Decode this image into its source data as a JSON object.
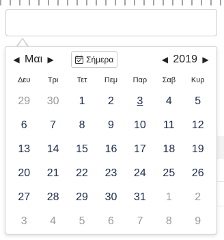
{
  "datepicker": {
    "input_value": "",
    "month": "Μαι",
    "year": "2019",
    "today_label": "Σήμερα",
    "weekdays": [
      "Δευ",
      "Τρι",
      "Τετ",
      "Πεμ",
      "Παρ",
      "Σαβ",
      "Κυρ"
    ],
    "weeks": [
      [
        {
          "d": "29",
          "other": true
        },
        {
          "d": "30",
          "other": true
        },
        {
          "d": "1"
        },
        {
          "d": "2"
        },
        {
          "d": "3",
          "today": true
        },
        {
          "d": "4"
        },
        {
          "d": "5"
        }
      ],
      [
        {
          "d": "6"
        },
        {
          "d": "7"
        },
        {
          "d": "8"
        },
        {
          "d": "9"
        },
        {
          "d": "10"
        },
        {
          "d": "11"
        },
        {
          "d": "12"
        }
      ],
      [
        {
          "d": "13"
        },
        {
          "d": "14"
        },
        {
          "d": "15"
        },
        {
          "d": "16"
        },
        {
          "d": "17"
        },
        {
          "d": "18"
        },
        {
          "d": "19"
        }
      ],
      [
        {
          "d": "20"
        },
        {
          "d": "21"
        },
        {
          "d": "22"
        },
        {
          "d": "23"
        },
        {
          "d": "24"
        },
        {
          "d": "25"
        },
        {
          "d": "26"
        }
      ],
      [
        {
          "d": "27"
        },
        {
          "d": "28"
        },
        {
          "d": "29"
        },
        {
          "d": "30"
        },
        {
          "d": "31"
        },
        {
          "d": "1",
          "other": true
        },
        {
          "d": "2",
          "other": true
        }
      ],
      [
        {
          "d": "3",
          "other": true
        },
        {
          "d": "4",
          "other": true
        },
        {
          "d": "5",
          "other": true
        },
        {
          "d": "6",
          "other": true
        },
        {
          "d": "7",
          "other": true
        },
        {
          "d": "8",
          "other": true
        },
        {
          "d": "9",
          "other": true
        }
      ]
    ],
    "icons": {
      "prev_month": "chevron-left-icon",
      "next_month": "chevron-right-icon",
      "prev_year": "chevron-left-icon",
      "next_year": "chevron-right-icon",
      "today": "calendar-icon"
    },
    "colors": {
      "day_text": "#1a2a4a",
      "other_month_text": "#9a9a9a",
      "border": "#d0d0d0"
    }
  }
}
